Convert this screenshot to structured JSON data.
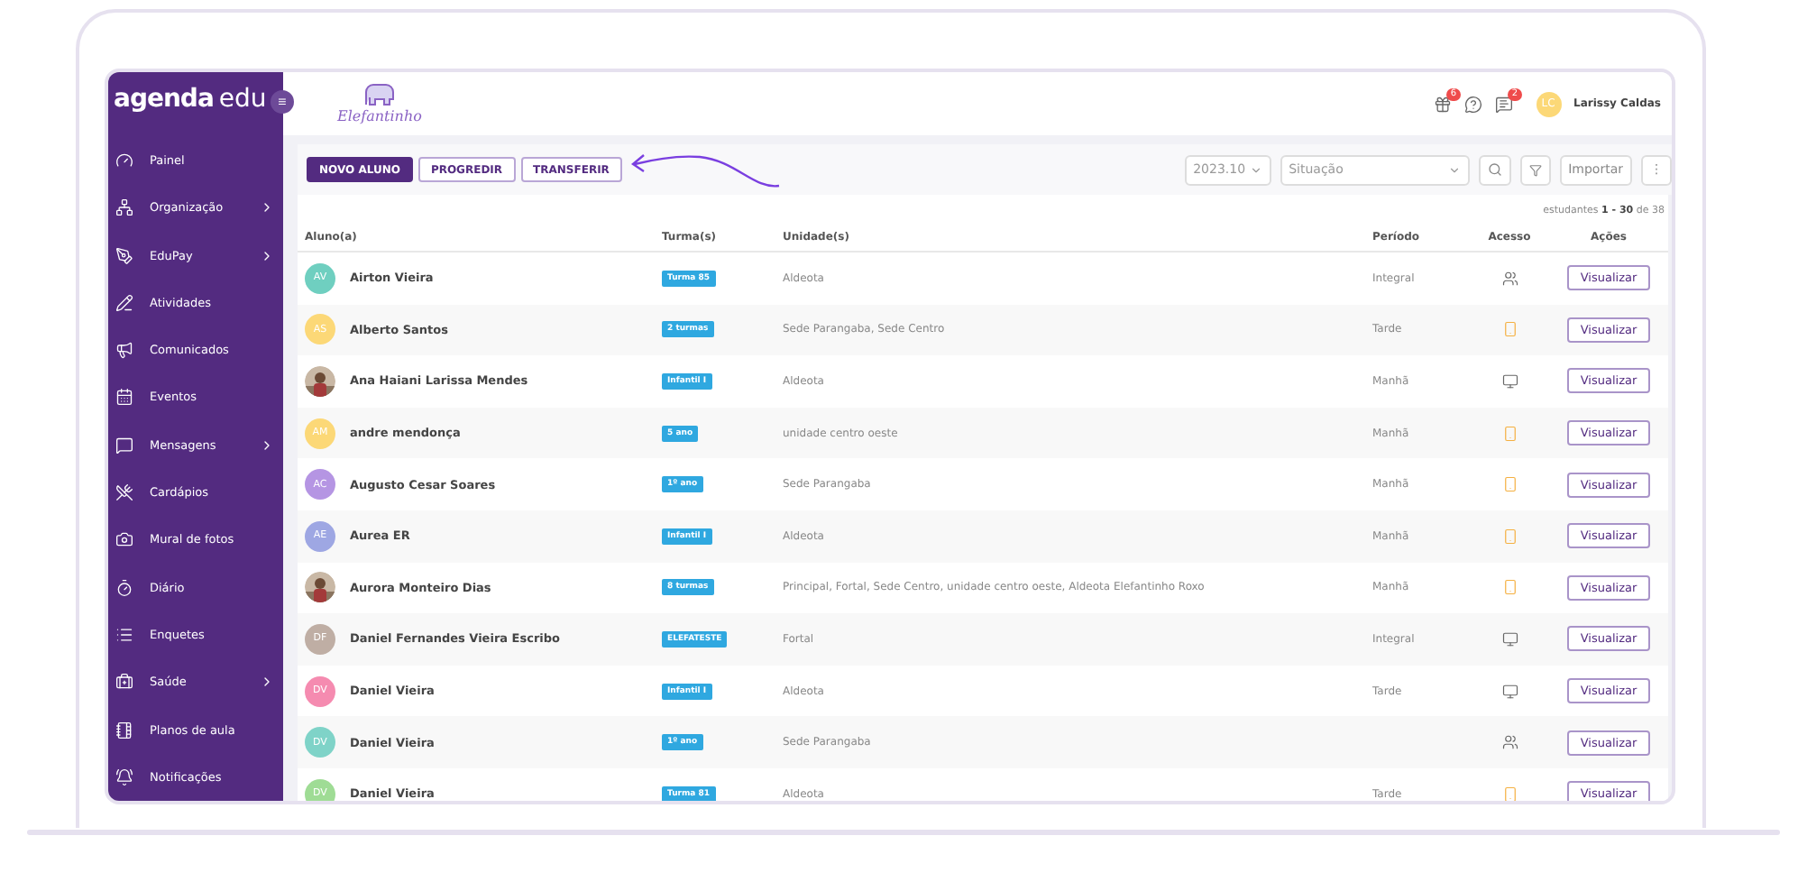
{
  "sidebar": {
    "brand_strong": "agenda",
    "brand_light": "edu",
    "menu_button": "≡",
    "items": [
      {
        "label": "Painel",
        "expandable": false
      },
      {
        "label": "Organização",
        "expandable": true
      },
      {
        "label": "EduPay",
        "expandable": true
      },
      {
        "label": "Atividades",
        "expandable": false
      },
      {
        "label": "Comunicados",
        "expandable": false
      },
      {
        "label": "Eventos",
        "expandable": false
      },
      {
        "label": "Mensagens",
        "expandable": true
      },
      {
        "label": "Cardápios",
        "expandable": false
      },
      {
        "label": "Mural de fotos",
        "expandable": false
      },
      {
        "label": "Diário",
        "expandable": false
      },
      {
        "label": "Enquetes",
        "expandable": false
      },
      {
        "label": "Saúde",
        "expandable": true
      },
      {
        "label": "Planos de aula",
        "expandable": false
      },
      {
        "label": "Notificações",
        "expandable": false
      }
    ]
  },
  "header": {
    "logo_text": "Elefantinho",
    "gift_count": "6",
    "message_count": "2",
    "user": {
      "initials": "LC",
      "name": "Larissy Caldas"
    }
  },
  "toolbar": {
    "buttons": [
      {
        "label": "NOVO ALUNO",
        "primary": true
      },
      {
        "label": "PROGREDIR",
        "primary": false
      },
      {
        "label": "TRANSFERIR",
        "primary": false
      }
    ],
    "period": "2023.10",
    "status_placeholder": "Situação",
    "import_button": "Importar",
    "more_button": "⋮"
  },
  "table": {
    "pagination": "estudantes **1 - 30** de 38",
    "columns": [
      "Aluno(a)",
      "Turma(s)",
      "Unidade(s)",
      "Período",
      "Acesso",
      "Ações"
    ],
    "rows": [
      {
        "avatar": {
          "kind": "initials",
          "initials": "AV",
          "color": "#6fcfc0"
        },
        "name": "Airton Vieira",
        "class": "Turma 85",
        "units": "Aldeota",
        "period": "Integral",
        "access": {
          "kind": "family"
        },
        "action": "Visualizar"
      },
      {
        "avatar": {
          "kind": "initials",
          "initials": "AS",
          "color": "#fcd877"
        },
        "name": "Alberto Santos",
        "class": "2 turmas",
        "units": "Sede Parangaba, Sede Centro",
        "period": "Tarde",
        "access": {
          "kind": "app"
        },
        "action": "Visualizar"
      },
      {
        "name": "Ana Haiani Larissa Mendes",
        "class": "Infantil I",
        "units": "Aldeota",
        "period": "Manhã",
        "access": {
          "kind": "web"
        },
        "action": "Visualizar"
      },
      {
        "avatar": {
          "kind": "initials",
          "initials": "AM",
          "color": "#fcd877"
        },
        "name": "andre mendonça",
        "class": "5 ano",
        "units": "unidade centro oeste",
        "period": "Manhã",
        "access": {
          "kind": "app"
        },
        "action": "Visualizar"
      },
      {
        "avatar": {
          "kind": "initials",
          "initials": "AC",
          "color": "#b595e3"
        },
        "name": "Augusto Cesar Soares",
        "class": "1º ano",
        "units": "Sede Parangaba",
        "period": "Manhã",
        "access": {
          "kind": "app"
        },
        "action": "Visualizar"
      },
      {
        "avatar": {
          "kind": "initials",
          "initials": "AE",
          "color": "#9ea7e3"
        },
        "name": "Aurea ER",
        "class": "Infantil I",
        "units": "Aldeota",
        "period": "Manhã",
        "access": {
          "kind": "app"
        },
        "action": "Visualizar"
      },
      {
        "name": "Aurora Monteiro Dias",
        "class": "8 turmas",
        "units": "Principal, Fortal, Sede Centro, unidade centro oeste, Aldeota Elefantinho Roxo",
        "period": "Manhã",
        "access": {
          "kind": "app"
        },
        "action": "Visualizar"
      },
      {
        "avatar": {
          "kind": "initials",
          "initials": "DF",
          "color": "#bfaea4"
        },
        "name": "Daniel Fernandes Vieira Escribo",
        "class": "ELEFATESTE",
        "units": "Fortal",
        "period": "Integral",
        "access": {
          "kind": "web"
        },
        "action": "Visualizar"
      },
      {
        "avatar": {
          "kind": "initials",
          "initials": "DV",
          "color": "#f58bb0"
        },
        "name": "Daniel Vieira",
        "class": "Infantil I",
        "units": "Aldeota",
        "period": "Tarde",
        "access": {
          "kind": "web"
        },
        "action": "Visualizar"
      },
      {
        "avatar": {
          "kind": "initials",
          "initials": "DV",
          "color": "#7fd3c8"
        },
        "name": "Daniel Vieira",
        "class": "1º ano",
        "units": "Sede Parangaba",
        "access": {
          "kind": "family"
        },
        "action": "Visualizar"
      },
      {
        "avatar": {
          "kind": "initials",
          "initials": "DV",
          "color": "#9fdc95"
        },
        "name": "Daniel Vieira",
        "class": "Turma 81",
        "units": "Aldeota",
        "period": "Tarde",
        "access": {
          "kind": "app"
        },
        "action": "Visualizar"
      }
    ]
  }
}
